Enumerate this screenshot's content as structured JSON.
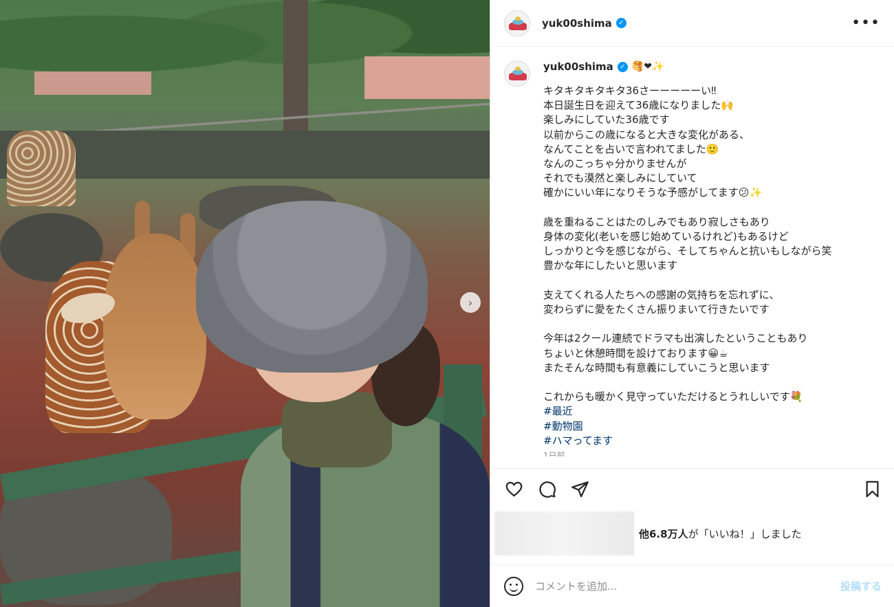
{
  "post": {
    "username": "yuk00shima",
    "more_icon": "more-horizontal-icon"
  },
  "caption": {
    "username": "yuk00shima",
    "emojis": "🥞❤✨",
    "text": "キタキタキタキタ36さーーーーーい‼︎\n本日誕生日を迎えて36歳になりました🙌\n楽しみにしていた36歳です\n以前からこの歳になると大きな変化がある、\nなんてことを占いで言われてました🙂\nなんのこっちゃ分かりませんが\nそれでも漠然と楽しみにしていて\n確かにいい年になりそうな予感がしてます😕✨\n\n歳を重ねることはたのしみでもあり寂しさもあり\n身体の変化(老いを感じ始めているけれど)もあるけど\nしっかりと今を感じながら、そしてちゃんと抗いもしながら笑\n豊かな年にしたいと思います\n\n支えてくれる人たちへの感謝の気持ちを忘れずに、\n変わらずに愛をたくさん振りまいて行きたいです\n\n今年は2クール連続でドラマも出演したということもあり\nちょいと休憩時間を設けております😀☕\nまたそんな時間も有意義にしていこうと思います\n\nこれからも暖かく見守っていただけるとうれしいです💐\n",
    "hashtags": [
      "#最近",
      "#動物園",
      "#ハマってます"
    ],
    "time_ago": "1日前"
  },
  "likes": {
    "count_text": "他6.8万人",
    "suffix": "が「いいね！」しました"
  },
  "comment": {
    "placeholder": "コメントを追加...",
    "post_label": "投稿する"
  },
  "colors": {
    "link": "#00376b",
    "verified": "#0095f6",
    "post_button": "#b2dffc",
    "muted": "#8e8e8e"
  }
}
